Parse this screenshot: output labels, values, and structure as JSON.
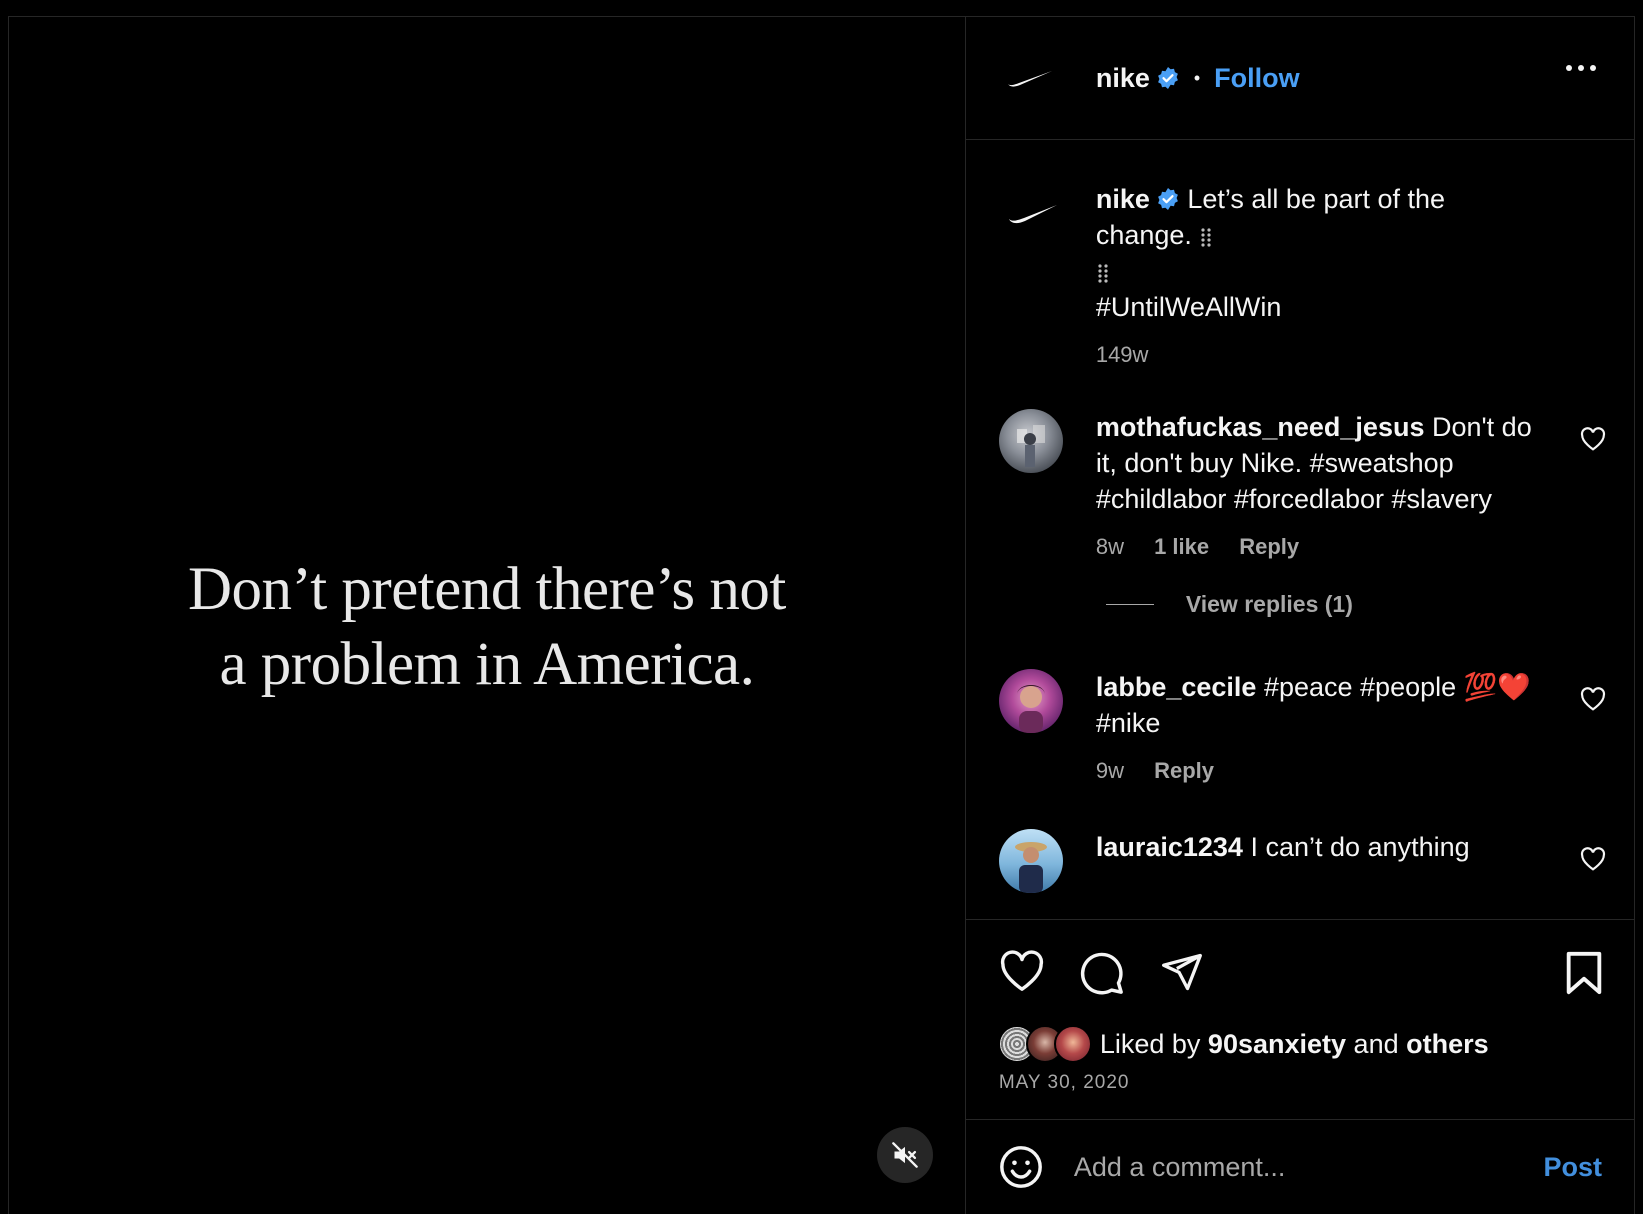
{
  "media": {
    "line1": "Don’t pretend there’s not",
    "line2": "a problem in America.",
    "mute_icon": "speaker-muted-icon"
  },
  "header": {
    "username": "nike",
    "verified_icon": "verified-badge-icon",
    "separator": "•",
    "follow_label": "Follow",
    "more_icon": "more-options-icon"
  },
  "caption": {
    "username": "nike",
    "text_line1": "Let’s all be part of the",
    "text_line2": "change.",
    "hashtag": "#UntilWeAllWin",
    "time": "149w"
  },
  "comments": [
    {
      "username": "mothafuckas_need_jesus",
      "text": "Don't do it, don't buy Nike. #sweatshop #childlabor #forcedlabor #slavery",
      "time": "8w",
      "likes": "1 like",
      "reply": "Reply",
      "view_replies": "View replies (1)"
    },
    {
      "username": "labbe_cecile",
      "text": "#peace #people 💯❤️ #nike",
      "time": "9w",
      "reply": "Reply"
    },
    {
      "username": "lauraic1234",
      "text": "I can’t do anything"
    }
  ],
  "actions": {
    "like_icon": "heart-icon",
    "comment_icon": "comment-icon",
    "share_icon": "share-icon",
    "save_icon": "bookmark-icon",
    "liked_by_prefix": "Liked by",
    "liked_by_user": "90sanxiety",
    "liked_by_and": "and",
    "liked_by_others": "others",
    "date": "MAY 30, 2020"
  },
  "add_comment": {
    "emoji_icon": "emoji-icon",
    "placeholder": "Add a comment...",
    "post_label": "Post"
  },
  "colors": {
    "background": "#000000",
    "accent": "#4a9ff5",
    "secondary_text": "#a8a8a8",
    "divider": "#262626"
  }
}
